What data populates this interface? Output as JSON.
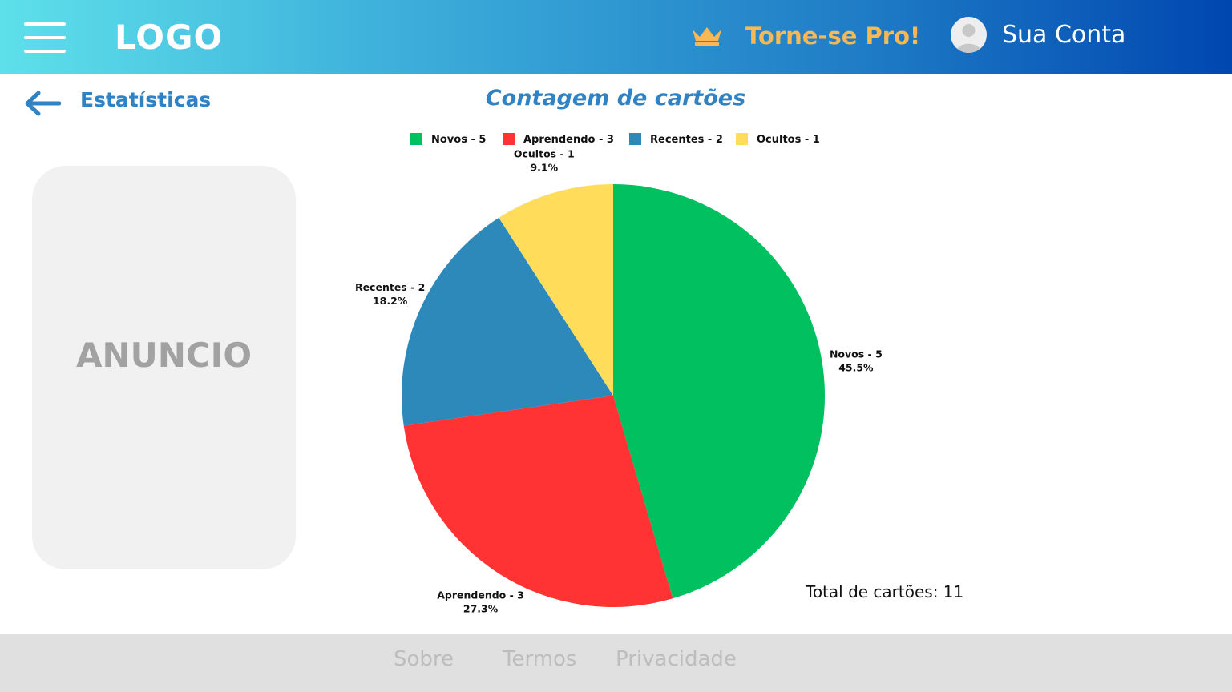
{
  "header": {
    "logo": "LOGO",
    "pro_label": "Torne-se Pro!",
    "account_label": "Sua Conta",
    "icons": {
      "menu": "hamburger-menu-icon",
      "crown": "crown-icon",
      "avatar": "user-avatar-icon"
    },
    "colors": {
      "gradient_start": "#5ee0ea",
      "gradient_end": "#0047b0",
      "pro": "#f7b955"
    }
  },
  "page": {
    "back_icon": "arrow-left-icon",
    "title": "Estatísticas"
  },
  "ad": {
    "label": "ANUNCIO"
  },
  "chart_data": {
    "type": "pie",
    "title": "Contagem de cartões",
    "legend_position": "top",
    "slices": [
      {
        "legend": "Novos - 5",
        "value": 5,
        "percent_label": "45.5%",
        "color": "#00c060"
      },
      {
        "legend": "Aprendendo - 3",
        "value": 3,
        "percent_label": "27.3%",
        "color": "#ff3333"
      },
      {
        "legend": "Recentes - 2",
        "value": 2,
        "percent_label": "18.2%",
        "color": "#2e89bb"
      },
      {
        "legend": "Ocultos - 1",
        "value": 1,
        "percent_label": "9.1%",
        "color": "#ffdd5a"
      }
    ]
  },
  "total_label": "Total de cartões: 11",
  "footer": {
    "links": [
      "Sobre",
      "Termos",
      "Privacidade"
    ]
  }
}
